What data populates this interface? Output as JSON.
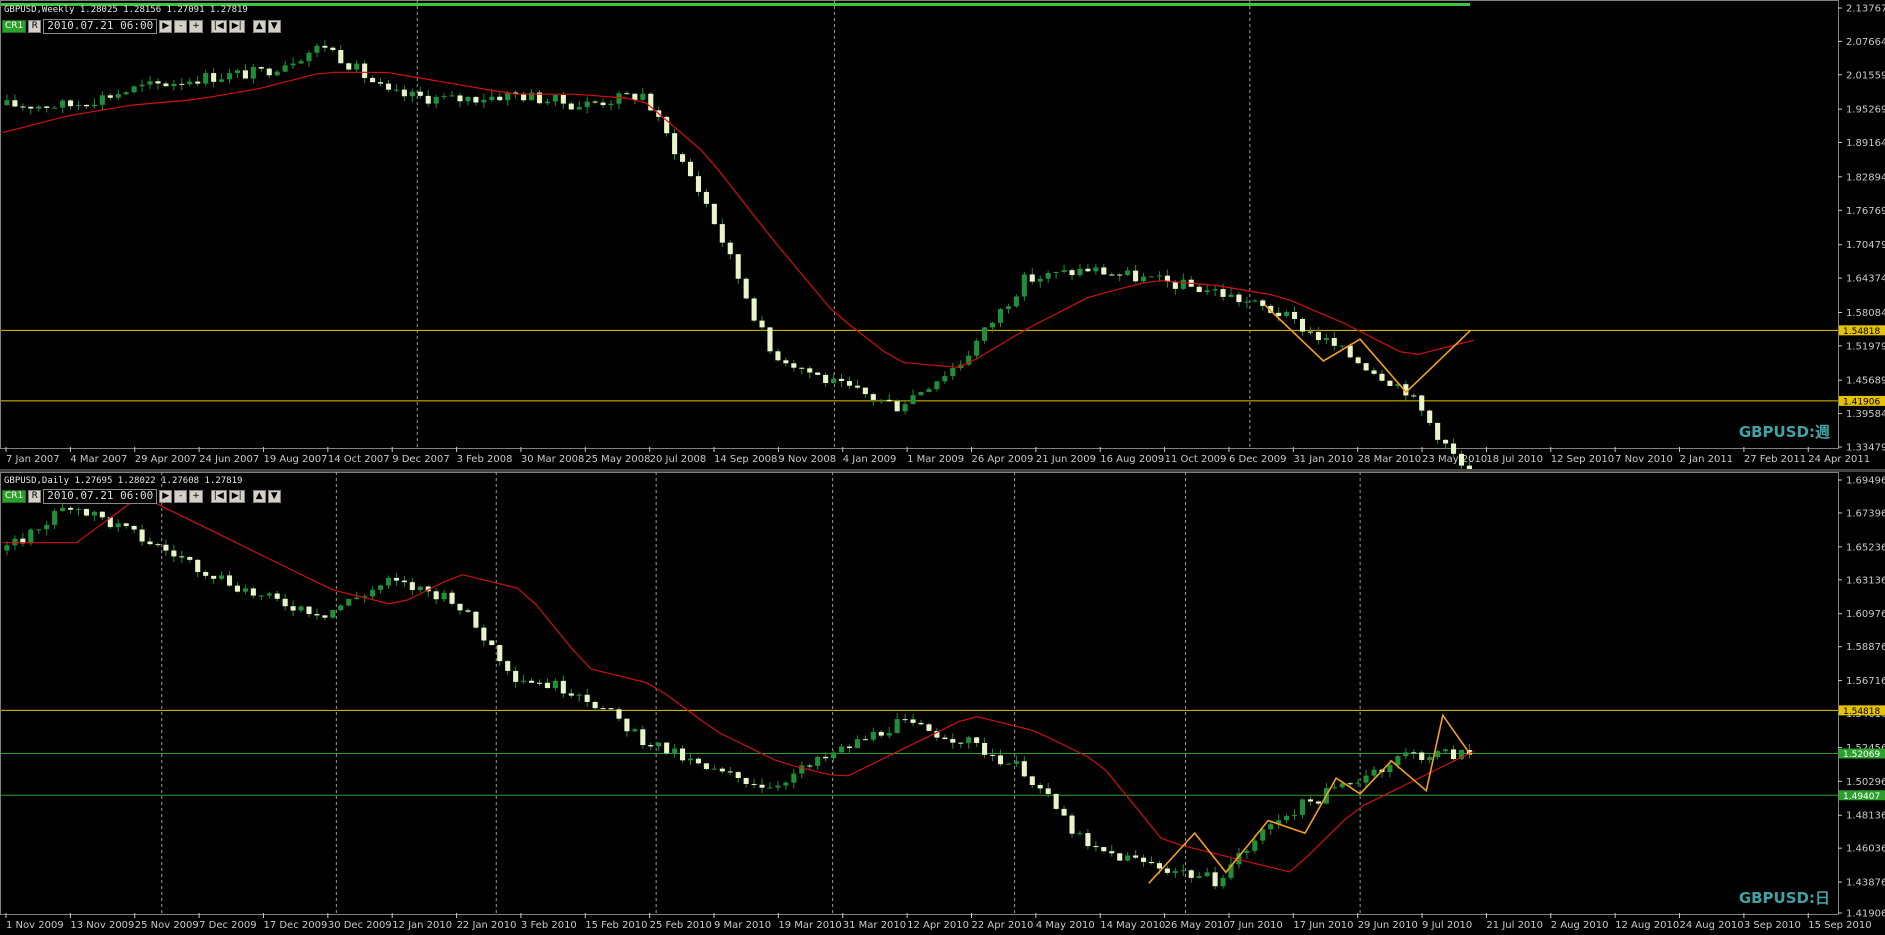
{
  "weekly": {
    "info_line": "GBPUSD,Weekly  1.28025 1.28156 1.27091 1.27819",
    "timeframe_badge": "CR1",
    "date_field": "2010.07.21 06:00",
    "watermark": "GBPUSD:週",
    "price_labels": [
      "2.13767",
      "2.07664",
      "2.01559",
      "1.95269",
      "1.89164",
      "1.82894",
      "1.76769",
      "1.70479",
      "1.64374",
      "1.58084",
      "1.51979",
      "1.45689",
      "1.39584",
      "1.33479"
    ],
    "hlines": [
      {
        "price": "1.54818",
        "color": "#e6c200"
      },
      {
        "price": "1.41906",
        "color": "#e6c200"
      }
    ],
    "date_labels": [
      "7 Jan 2007",
      "4 Mar 2007",
      "29 Apr 2007",
      "24 Jun 2007",
      "19 Aug 2007",
      "14 Oct 2007",
      "9 Dec 2007",
      "3 Feb 2008",
      "30 Mar 2008",
      "25 May 2008",
      "20 Jul 2008",
      "14 Sep 2008",
      "9 Nov 2008",
      "4 Jan 2009",
      "1 Mar 2009",
      "26 Apr 2009",
      "21 Jun 2009",
      "16 Aug 2009",
      "11 Oct 2009",
      "6 Dec 2009",
      "31 Jan 2010",
      "28 Mar 2010",
      "23 May 2010",
      "18 Jul 2010",
      "12 Sep 2010",
      "7 Nov 2010",
      "2 Jan 2011",
      "27 Feb 2011",
      "24 Apr 2011"
    ],
    "chart_data": {
      "type": "candlestick",
      "ylim": [
        1.33479,
        2.13767
      ],
      "x": [
        "7 Jan 2007",
        "4 Mar 2007",
        "29 Apr 2007",
        "24 Jun 2007",
        "19 Aug 2007",
        "14 Oct 2007",
        "9 Dec 2007",
        "3 Feb 2008",
        "30 Mar 2008",
        "25 May 2008",
        "20 Jul 2008",
        "14 Sep 2008",
        "9 Nov 2008",
        "4 Jan 2009",
        "1 Mar 2009",
        "26 Apr 2009",
        "21 Jun 2009",
        "16 Aug 2009",
        "11 Oct 2009",
        "6 Dec 2009",
        "31 Jan 2010",
        "28 Mar 2010",
        "23 May 2010",
        "18 Jul 2010"
      ],
      "close": [
        1.96,
        1.96,
        1.99,
        2.01,
        2.02,
        2.07,
        1.98,
        1.97,
        1.98,
        1.96,
        1.98,
        1.78,
        1.51,
        1.45,
        1.41,
        1.49,
        1.64,
        1.66,
        1.64,
        1.62,
        1.58,
        1.51,
        1.44,
        1.278
      ],
      "ma": [
        1.91,
        1.94,
        1.96,
        1.97,
        1.99,
        2.02,
        2.02,
        2.0,
        1.98,
        1.98,
        1.97,
        1.87,
        1.72,
        1.58,
        1.49,
        1.48,
        1.55,
        1.61,
        1.64,
        1.63,
        1.61,
        1.56,
        1.5,
        1.53
      ]
    }
  },
  "daily": {
    "info_line": "GBPUSD,Daily  1.27695 1.28022 1.27608 1.27819",
    "timeframe_badge": "CR1",
    "date_field": "2010.07.21 06:00",
    "watermark": "GBPUSD:日",
    "price_labels": [
      "1.69496",
      "1.67396",
      "1.65236",
      "1.63136",
      "1.60976",
      "1.58876",
      "1.56716",
      "1.54616",
      "1.52456",
      "1.50296",
      "1.48136",
      "1.46036",
      "1.43876",
      "1.41906"
    ],
    "hlines": [
      {
        "price": "1.54818",
        "color": "#e6c200"
      },
      {
        "price": "1.52069",
        "color": "#2ca02c"
      },
      {
        "price": "1.49407",
        "color": "#2ca02c"
      }
    ],
    "date_labels": [
      "1 Nov 2009",
      "13 Nov 2009",
      "25 Nov 2009",
      "7 Dec 2009",
      "17 Dec 2009",
      "30 Dec 2009",
      "12 Jan 2010",
      "22 Jan 2010",
      "3 Feb 2010",
      "15 Feb 2010",
      "25 Feb 2010",
      "9 Mar 2010",
      "19 Mar 2010",
      "31 Mar 2010",
      "12 Apr 2010",
      "22 Apr 2010",
      "4 May 2010",
      "14 May 2010",
      "26 May 2010",
      "7 Jun 2010",
      "17 Jun 2010",
      "29 Jun 2010",
      "9 Jul 2010",
      "21 Jul 2010",
      "2 Aug 2010",
      "12 Aug 2010",
      "24 Aug 2010",
      "3 Sep 2010",
      "15 Sep 2010"
    ],
    "chart_data": {
      "type": "candlestick",
      "ylim": [
        1.41906,
        1.69496
      ],
      "x": [
        "1 Nov 2009",
        "13 Nov 2009",
        "25 Nov 2009",
        "7 Dec 2009",
        "17 Dec 2009",
        "30 Dec 2009",
        "12 Jan 2010",
        "22 Jan 2010",
        "3 Feb 2010",
        "15 Feb 2010",
        "25 Feb 2010",
        "9 Mar 2010",
        "19 Mar 2010",
        "31 Mar 2010",
        "12 Apr 2010",
        "22 Apr 2010",
        "4 May 2010",
        "14 May 2010",
        "26 May 2010",
        "7 Jun 2010",
        "17 Jun 2010",
        "29 Jun 2010",
        "9 Jul 2010",
        "21 Jul 2010"
      ],
      "close": [
        1.65,
        1.68,
        1.66,
        1.64,
        1.62,
        1.61,
        1.63,
        1.62,
        1.57,
        1.56,
        1.53,
        1.51,
        1.5,
        1.52,
        1.54,
        1.53,
        1.51,
        1.46,
        1.45,
        1.44,
        1.48,
        1.5,
        1.52,
        1.52
      ]
    }
  }
}
